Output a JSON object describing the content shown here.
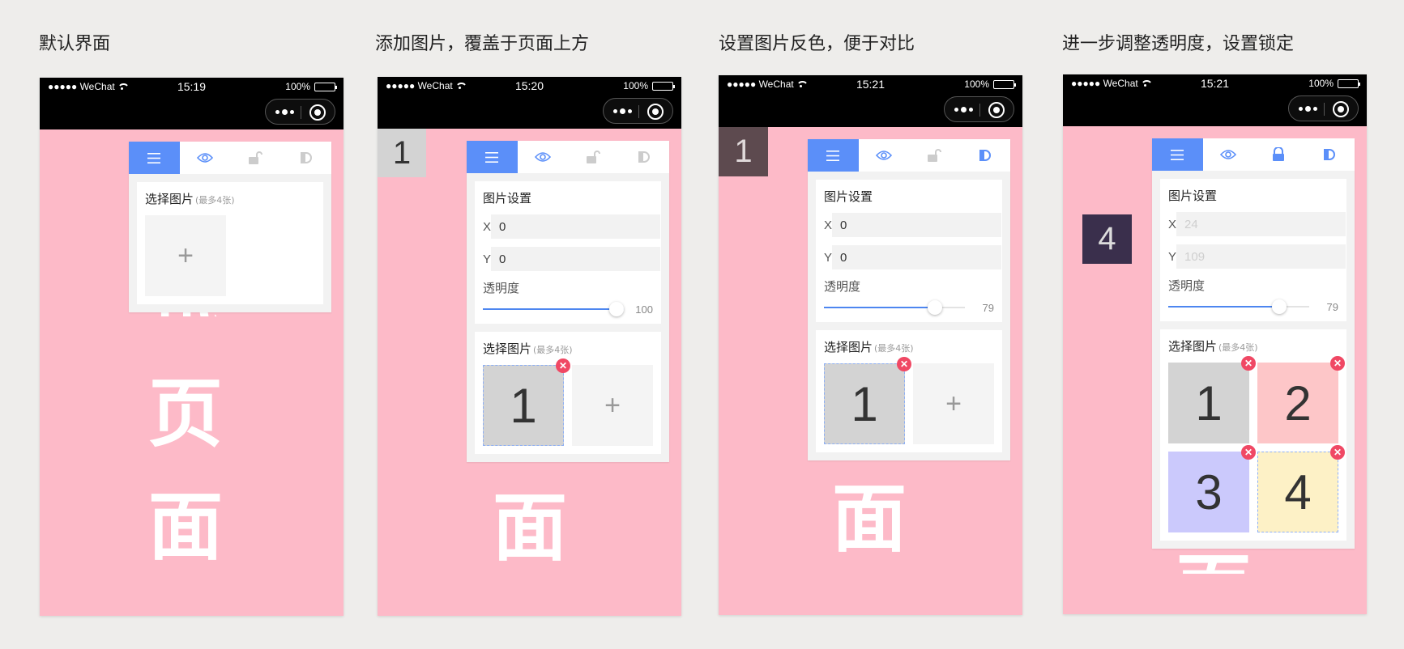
{
  "colors": {
    "page_bg": "#eeedeb",
    "phone_bg": "#fdbac8",
    "accent": "#5b8ff9",
    "delete": "#f04864",
    "inactive_icon": "#cccccc"
  },
  "icons": [
    "menu-icon",
    "eye-icon",
    "lock-icon",
    "invert-icon",
    "close-icon",
    "plus-icon",
    "more-icon",
    "target-icon",
    "wifi-icon",
    "battery-icon"
  ],
  "steps": [
    {
      "caption": "默认界面",
      "status": {
        "carrier": "●●●●● WeChat",
        "time": "15:19",
        "battery": "100%"
      },
      "bg_chars": [
        "试",
        "页",
        "面"
      ],
      "select_title": "选择图片",
      "select_hint": "(最多4张)",
      "add_symbol": "+"
    },
    {
      "caption": "添加图片，覆盖于页面上方",
      "status": {
        "carrier": "●●●●● WeChat",
        "time": "15:20",
        "battery": "100%"
      },
      "bg_chars": [
        "面"
      ],
      "overlay_label": "1",
      "settings_title": "图片设置",
      "x_label": "X",
      "x_value": "0",
      "y_label": "Y",
      "y_value": "0",
      "opacity_label": "透明度",
      "opacity_value": "100",
      "opacity_fraction": 1.0,
      "select_title": "选择图片",
      "select_hint": "(最多4张)",
      "thumbs": [
        "1"
      ],
      "add_symbol": "+"
    },
    {
      "caption": "设置图片反色，便于对比",
      "status": {
        "carrier": "●●●●● WeChat",
        "time": "15:21",
        "battery": "100%"
      },
      "bg_chars": [
        "面"
      ],
      "overlay_label": "1",
      "settings_title": "图片设置",
      "x_label": "X",
      "x_value": "0",
      "y_label": "Y",
      "y_value": "0",
      "opacity_label": "透明度",
      "opacity_value": "79",
      "opacity_fraction": 0.79,
      "select_title": "选择图片",
      "select_hint": "(最多4张)",
      "thumbs": [
        "1"
      ],
      "add_symbol": "+"
    },
    {
      "caption": "进一步调整透明度，设置锁定",
      "status": {
        "carrier": "●●●●● WeChat",
        "time": "15:21",
        "battery": "100%"
      },
      "bg_chars": [
        "面"
      ],
      "overlay_label": "4",
      "settings_title": "图片设置",
      "x_label": "X",
      "x_value": "24",
      "y_label": "Y",
      "y_value": "109",
      "opacity_label": "透明度",
      "opacity_value": "79",
      "opacity_fraction": 0.79,
      "select_title": "选择图片",
      "select_hint": "(最多4张)",
      "thumbs": [
        "1",
        "2",
        "3",
        "4"
      ]
    }
  ]
}
